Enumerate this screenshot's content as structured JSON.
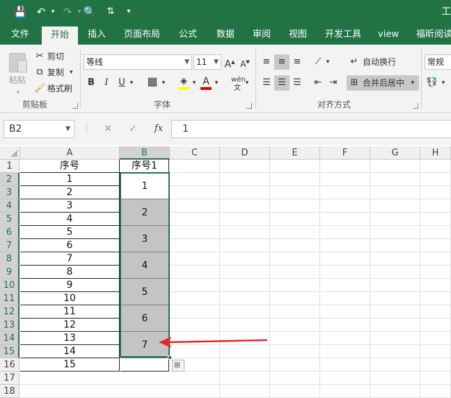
{
  "titlebar": {
    "title_fragment": "工"
  },
  "tabs": [
    "文件",
    "开始",
    "插入",
    "页面布局",
    "公式",
    "数据",
    "审阅",
    "视图",
    "开发工具",
    "view",
    "福昕阅读"
  ],
  "ribbon": {
    "clipboard": {
      "paste": "粘贴",
      "cut": "剪切",
      "copy": "复制",
      "format_painter": "格式刷",
      "group": "剪贴板"
    },
    "font": {
      "name": "等线",
      "size": "11",
      "bold": "B",
      "italic": "I",
      "underline": "U",
      "phonetic": "wén",
      "group": "字体"
    },
    "alignment": {
      "wrap": "自动换行",
      "merge": "合并后居中",
      "group": "对齐方式"
    },
    "number": {
      "format": "常规"
    }
  },
  "formula_bar": {
    "name_box": "B2",
    "cancel": "✕",
    "confirm": "✓",
    "fx": "fx",
    "value": "1"
  },
  "columns": [
    "A",
    "B",
    "C",
    "D",
    "E",
    "F",
    "G",
    "H"
  ],
  "rows": [
    "1",
    "2",
    "3",
    "4",
    "5",
    "6",
    "7",
    "8",
    "9",
    "10",
    "11",
    "12",
    "13",
    "14",
    "15",
    "16",
    "17",
    "18"
  ],
  "sheet": {
    "a_header": "序号",
    "b_header": "序号1",
    "col_a": [
      "1",
      "2",
      "3",
      "4",
      "5",
      "6",
      "7",
      "8",
      "9",
      "10",
      "11",
      "12",
      "13",
      "14",
      "15"
    ],
    "col_b_merged": [
      "1",
      "2",
      "3",
      "4",
      "5",
      "6",
      "7"
    ]
  },
  "colors": {
    "accent": "#217346",
    "arrow": "#e5252a",
    "merged_fill": "#c4c4c4"
  }
}
